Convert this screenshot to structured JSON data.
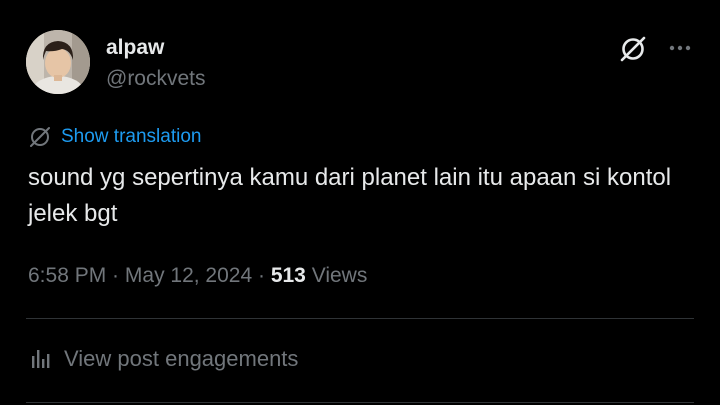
{
  "author": {
    "display_name": "alpaw",
    "handle": "@rockvets",
    "avatar": "profile-photo"
  },
  "header_actions": {
    "grok_icon": "grok-slash-circle-icon",
    "more_icon": "ellipsis-icon"
  },
  "translation": {
    "icon": "translate-globe-icon",
    "label": "Show translation"
  },
  "post": {
    "text": "sound yg sepertinya kamu dari planet lain itu apaan si kontol jelek bgt"
  },
  "meta": {
    "time": "6:58 PM",
    "separator_1": " · ",
    "date": "May 12, 2024",
    "separator_2": " · ",
    "views_count": "513",
    "views_label": " Views"
  },
  "engagements": {
    "icon": "analytics-bar-icon",
    "label": "View post engagements"
  },
  "colors": {
    "background": "#000000",
    "primary_text": "#e7e9ea",
    "secondary_text": "#71767b",
    "accent": "#1d9bf0",
    "divider": "#2f3336"
  }
}
